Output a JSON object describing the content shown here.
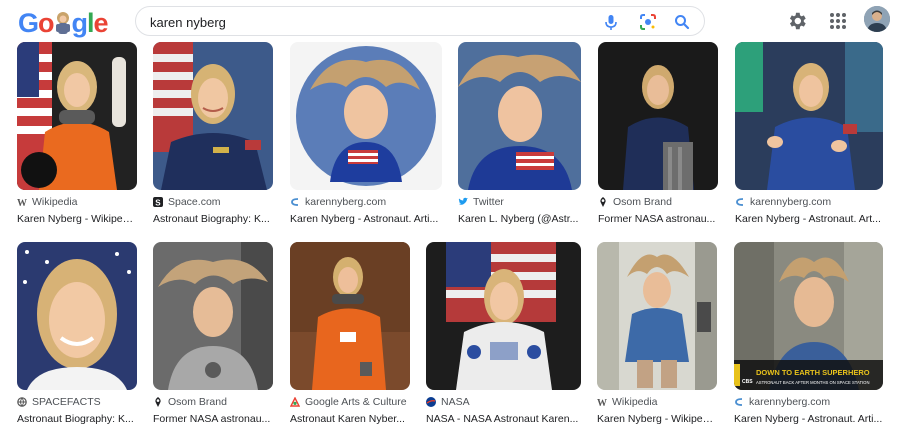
{
  "search": {
    "query": "karen nyberg"
  },
  "logo": {
    "text": "Google",
    "letters": [
      "G",
      "o",
      "",
      "g",
      "l",
      "e"
    ]
  },
  "colors": {
    "blue": "#4285f4",
    "red": "#ea4335",
    "yellow": "#fbbc05",
    "green": "#34a853",
    "text": "#202124",
    "muted": "#4d5156"
  },
  "header_icons": [
    "mic-icon",
    "camera-lens-icon",
    "search-icon",
    "gear-icon",
    "apps-grid-icon",
    "account-avatar"
  ],
  "results": [
    {
      "source": "Wikipedia",
      "favicon": "wikipedia-icon",
      "title": "Karen Nyberg - Wikiped..."
    },
    {
      "source": "Space.com",
      "favicon": "space-com-icon",
      "title": "Astronaut Biography: K..."
    },
    {
      "source": "karennyberg.com",
      "favicon": "karennyberg-icon",
      "title": "Karen Nyberg - Astronaut. Arti..."
    },
    {
      "source": "Twitter",
      "favicon": "twitter-icon",
      "title": "Karen L. Nyberg (@Astr..."
    },
    {
      "source": "Osom Brand",
      "favicon": "osom-brand-icon",
      "title": "Former NASA astronau..."
    },
    {
      "source": "karennyberg.com",
      "favicon": "karennyberg-icon",
      "title": "Karen Nyberg - Astronaut. Art..."
    },
    {
      "source": "SPACEFACTS",
      "favicon": "spacefacts-icon",
      "title": "Astronaut Biography: K..."
    },
    {
      "source": "Osom Brand",
      "favicon": "osom-brand-icon",
      "title": "Former NASA astronau..."
    },
    {
      "source": "Google Arts & Culture",
      "favicon": "google-arts-icon",
      "title": "Astronaut Karen Nyber..."
    },
    {
      "source": "NASA",
      "favicon": "nasa-icon",
      "title": "NASA - NASA Astronaut Karen..."
    },
    {
      "source": "Wikipedia",
      "favicon": "wikipedia-icon",
      "title": "Karen Nyberg - Wikiped..."
    },
    {
      "source": "karennyberg.com",
      "favicon": "karennyberg-icon",
      "title": "Karen Nyberg - Astronaut. Arti..."
    }
  ],
  "image_overlay": {
    "headline": "DOWN TO EARTH SUPERHERO",
    "subline": "ASTRONAUT BACK AFTER MONTHS ON SPACE STATION",
    "channel": "CBS"
  }
}
